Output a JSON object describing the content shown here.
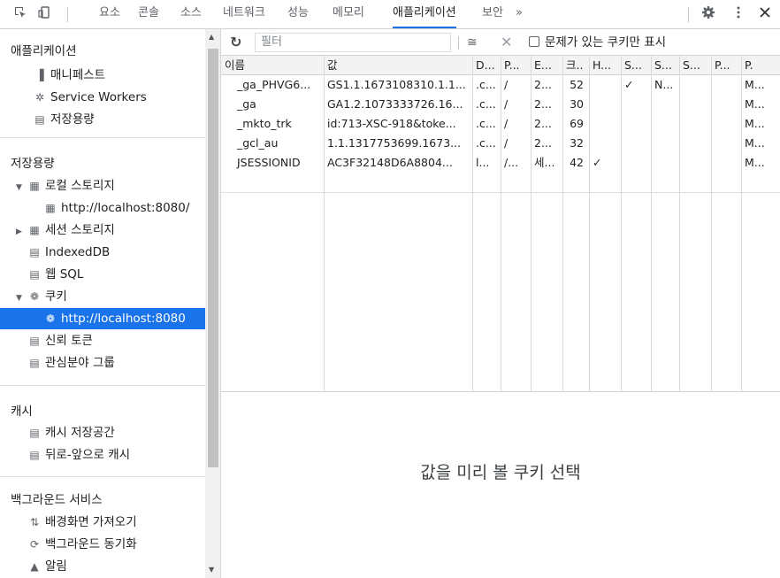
{
  "tabs": [
    "요소",
    "콘솔",
    "소스",
    "네트워크",
    "성능",
    "메모리",
    "애플리케이션",
    "보안",
    "»"
  ],
  "active_tab": 6,
  "sidebar": {
    "app_title": "애플리케이션",
    "app_items": [
      "매니페스트",
      "Service Workers",
      "저장용량"
    ],
    "storage_title": "저장용량",
    "local_storage": "로컬 스토리지",
    "local_storage_origin": "http://localhost:8080/",
    "session_storage": "세션 스토리지",
    "indexeddb": "IndexedDB",
    "websql": "웹 SQL",
    "cookies": "쿠키",
    "cookies_origin": "http://localhost:8080",
    "trust_tokens": "신뢰 토큰",
    "interest_groups": "관심분야 그룹",
    "cache_title": "캐시",
    "cache_storage": "캐시 저장공간",
    "bfcache": "뒤로-앞으로 캐시",
    "bg_title": "백그라운드 서비스",
    "bg_fetch": "배경화면 가져오기",
    "bg_sync": "백그라운드 동기화",
    "notifications": "알림"
  },
  "toolbar": {
    "filter_placeholder": "필터",
    "issues_only_label": "문제가 있는 쿠키만 표시"
  },
  "columns": [
    "이름",
    "값",
    "D...",
    "P...",
    "E...",
    "크..",
    "H...",
    "S...",
    "S...",
    "S...",
    "P...",
    "P."
  ],
  "rows": [
    [
      "_ga_PHVG6...",
      "GS1.1.1673108310.1.1...",
      ".c...",
      "/",
      "2...",
      "52",
      "",
      "✓",
      "N...",
      "",
      "",
      "M..."
    ],
    [
      "_ga",
      "GA1.2.1073333726.16...",
      ".c...",
      "/",
      "2...",
      "30",
      "",
      "",
      "",
      "",
      "",
      "M..."
    ],
    [
      "_mkto_trk",
      "id:713-XSC-918&toke...",
      ".c...",
      "/",
      "2...",
      "69",
      "",
      "",
      "",
      "",
      "",
      "M..."
    ],
    [
      "_gcl_au",
      "1.1.1317753699.1673...",
      ".c...",
      "/",
      "2...",
      "32",
      "",
      "",
      "",
      "",
      "",
      "M..."
    ],
    [
      "JSESSIONID",
      "AC3F32148D6A8804...",
      "l...",
      "/...",
      "세...",
      "42",
      "✓",
      "",
      "",
      "",
      "",
      "M..."
    ]
  ],
  "empty_message": "값을 미리 볼 쿠키 선택"
}
